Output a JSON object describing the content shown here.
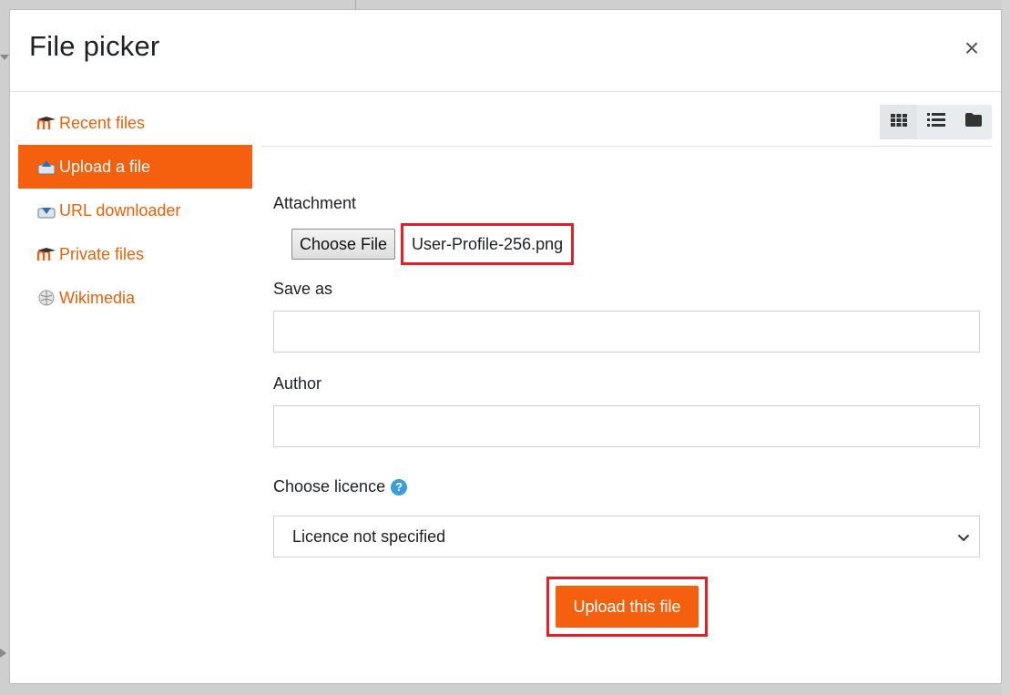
{
  "dialog": {
    "title": "File picker",
    "close_glyph": "×"
  },
  "sidebar": {
    "items": [
      {
        "label": "Recent files",
        "icon": "moodle-icon",
        "active": false
      },
      {
        "label": "Upload a file",
        "icon": "upload-icon",
        "active": true
      },
      {
        "label": "URL downloader",
        "icon": "download-icon",
        "active": false
      },
      {
        "label": "Private files",
        "icon": "moodle-icon",
        "active": false
      },
      {
        "label": "Wikimedia",
        "icon": "globe-icon",
        "active": false
      }
    ]
  },
  "toolbar": {
    "views": [
      "grid-view-icon",
      "list-view-icon",
      "folder-view-icon"
    ]
  },
  "form": {
    "attachment_label": "Attachment",
    "choose_file_label": "Choose File",
    "chosen_file_name": "User-Profile-256.png",
    "save_as_label": "Save as",
    "save_as_value": "",
    "author_label": "Author",
    "author_value": "",
    "licence_label": "Choose licence",
    "licence_value": "Licence not specified",
    "upload_label": "Upload this file"
  },
  "colors": {
    "accent": "#f4600d",
    "highlight": "#e3202a",
    "help": "#3c9ed8"
  }
}
